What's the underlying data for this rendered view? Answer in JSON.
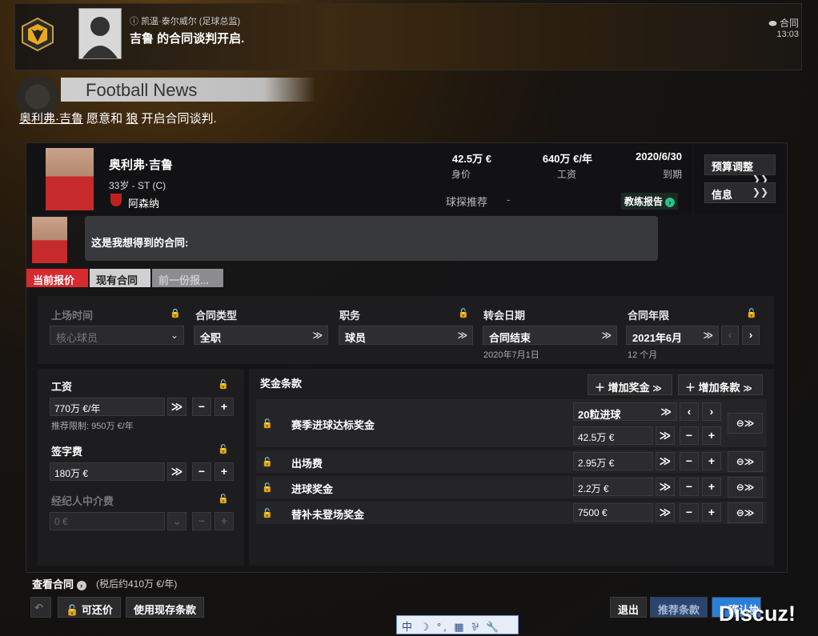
{
  "inbox": {
    "sender": "凯温·泰尔威尔 (足球总监)",
    "headline": "吉鲁 的合同谈判开启.",
    "type": "合同",
    "time": "13:03"
  },
  "news": {
    "section_title": "Football News",
    "player_link": "奥利弗·吉鲁",
    "text_middle": " 愿意和 ",
    "club_link": "狼",
    "text_end": " 开启合同谈判."
  },
  "player": {
    "name": "奥利弗·吉鲁",
    "age_pos": "33岁 - ST (C)",
    "club": "阿森纳",
    "value": "42.5万 €",
    "value_label": "身价",
    "wage": "640万 €/年",
    "wage_label": "工资",
    "expires": "2020/6/30",
    "expires_label": "到期",
    "scout_label": "球探推荐",
    "scout_value": "-",
    "coach_report": "教练报告"
  },
  "side": {
    "budget": "预算调整",
    "info": "信息"
  },
  "agent_message": "这是我想得到的合同:",
  "tabs": {
    "current": "当前报价",
    "existing": "现有合同",
    "previous": "前一份报..."
  },
  "fields": {
    "playing_time_label": "上场时间",
    "playing_time_value": "核心球员",
    "contract_type_label": "合同类型",
    "contract_type_value": "全职",
    "role_label": "职务",
    "role_value": "球员",
    "transfer_date_label": "转会日期",
    "transfer_date_value": "合同结束",
    "transfer_date_sub": "2020年7月1日",
    "length_label": "合同年限",
    "length_value": "2021年6月",
    "length_sub": "12 个月"
  },
  "wage": {
    "label": "工资",
    "value": "770万 €/年",
    "limit": "推荐限制: 950万 €/年"
  },
  "signing": {
    "label": "签字费",
    "value": "180万 €"
  },
  "agent_fee": {
    "label": "经纪人中介费",
    "value": "0 €"
  },
  "bonuses": {
    "title": "奖金条款",
    "add_bonus": "增加奖金",
    "add_clause": "增加条款",
    "rows": [
      {
        "name": "赛季进球达标奖金",
        "goals": "20粒进球",
        "value": "42.5万 €"
      },
      {
        "name": "出场费",
        "value": "2.95万 €"
      },
      {
        "name": "进球奖金",
        "value": "2.2万 €"
      },
      {
        "name": "替补未登场奖金",
        "value": "7500 €"
      }
    ]
  },
  "bottom": {
    "view_contract": "查看合同",
    "after_tax": "(税后约410万 €/年)",
    "negotiable": "可还价",
    "use_existing": "使用现存条款",
    "exit": "退出",
    "recommend": "推荐条款",
    "confirm": "确认协议"
  },
  "ime": "中 ☽ °, ▦ ⅌ 🔧",
  "watermark": "Discuz!"
}
